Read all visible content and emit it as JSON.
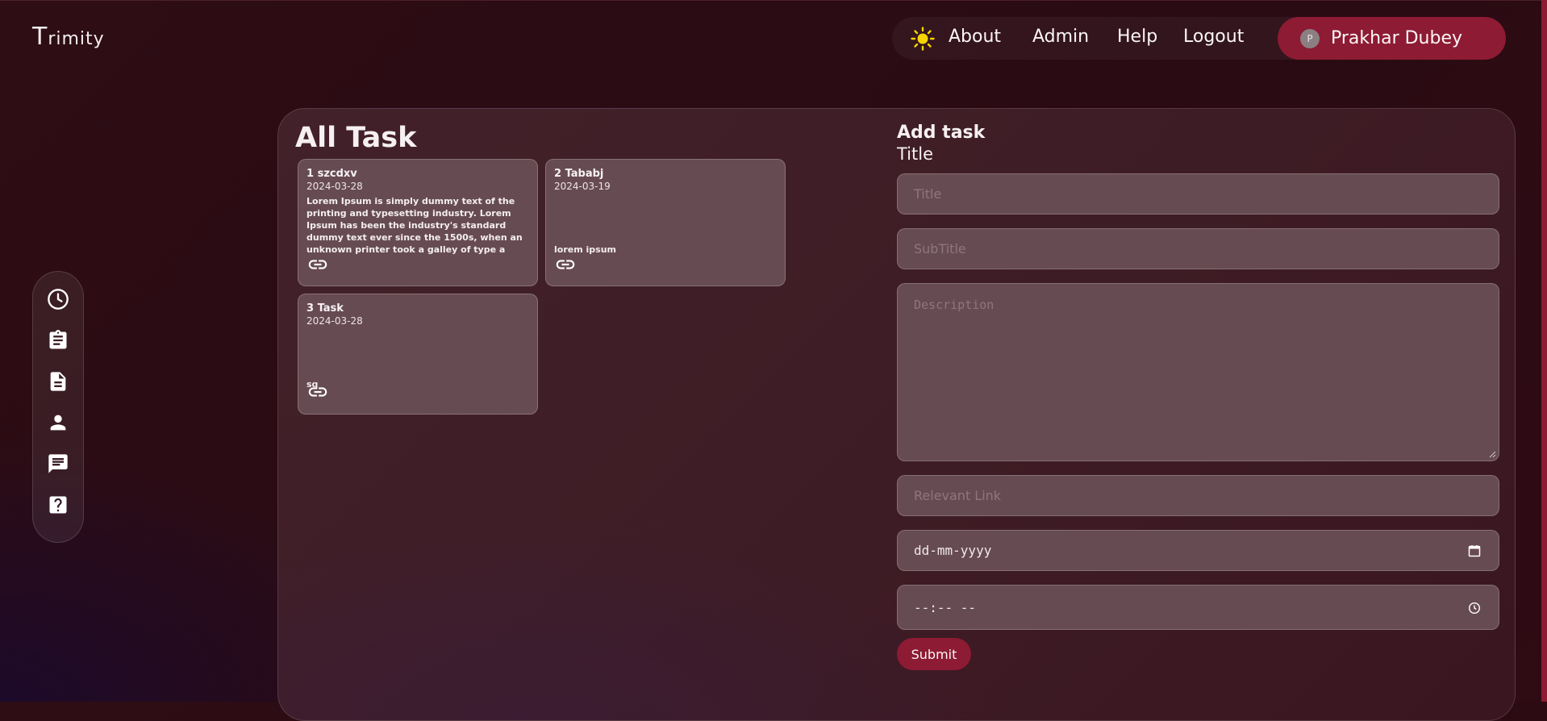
{
  "app": {
    "logo_first": "T",
    "logo_rest": "rimity"
  },
  "nav": {
    "theme_icon": "sun-icon",
    "links": [
      "About",
      "Admin",
      "Help",
      "Logout"
    ],
    "user": {
      "initial": "P",
      "name": "Prakhar Dubey"
    }
  },
  "sidebar": {
    "icons": [
      "clock-icon",
      "clipboard-icon",
      "document-icon",
      "person-icon",
      "chat-icon",
      "help-icon"
    ]
  },
  "tasks": {
    "heading": "All Task",
    "items": [
      {
        "number": "1",
        "name": "szcdxv",
        "date": "2024-03-28",
        "description": "Lorem Ipsum is simply dummy text of the printing and typesetting industry. Lorem Ipsum has been the industry's standard dummy text ever since the 1500s, when an unknown printer took a galley of type a"
      },
      {
        "number": "2",
        "name": "Tababj",
        "date": "2024-03-19",
        "description": "lorem ipsum"
      },
      {
        "number": "3",
        "name": "Task",
        "date": "2024-03-28",
        "description": "sq"
      }
    ]
  },
  "form": {
    "heading": "Add task",
    "label": "Title",
    "title_placeholder": "Title",
    "subtitle_placeholder": "SubTitle",
    "description_placeholder": "Description",
    "link_placeholder": "Relevant Link",
    "date_placeholder": "dd-mm-yyyy",
    "time_placeholder": "--:-- --",
    "submit_label": "Submit"
  },
  "colors": {
    "accent": "#8d1b33",
    "card": "#674b53",
    "sun": "#f5d400"
  }
}
